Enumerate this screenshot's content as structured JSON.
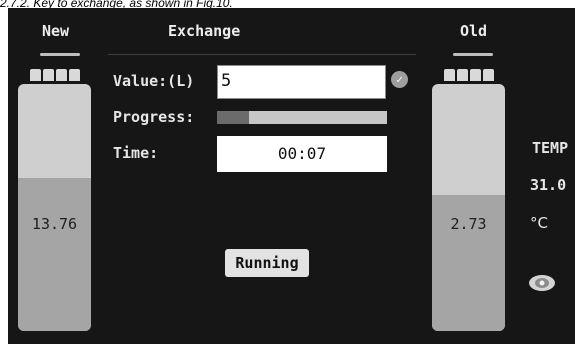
{
  "caption": "2.7.2. Key to exchange, as shown in Fig.10.",
  "header": {
    "new_title": "New",
    "exchange_title": "Exchange",
    "old_title": "Old"
  },
  "tanks": {
    "new": {
      "reading": "13.76",
      "fill_fraction": 0.62
    },
    "old": {
      "reading": "2.73",
      "fill_fraction": 0.55
    }
  },
  "form": {
    "value_label": "Value:(L)",
    "value": "5",
    "progress_label": "Progress:",
    "progress_fraction": 0.19,
    "time_label": "Time:",
    "time_value": "00:07"
  },
  "run_button": {
    "label": "Running"
  },
  "temperature": {
    "label": "TEMP",
    "value": "31.0",
    "unit": "°C"
  },
  "icons": {
    "confirm": "check-circle-icon",
    "view": "eye-icon"
  },
  "colors": {
    "screen_bg": "#161616",
    "tank_empty": "#cfcfcf",
    "tank_fill": "#a5a5a5"
  }
}
